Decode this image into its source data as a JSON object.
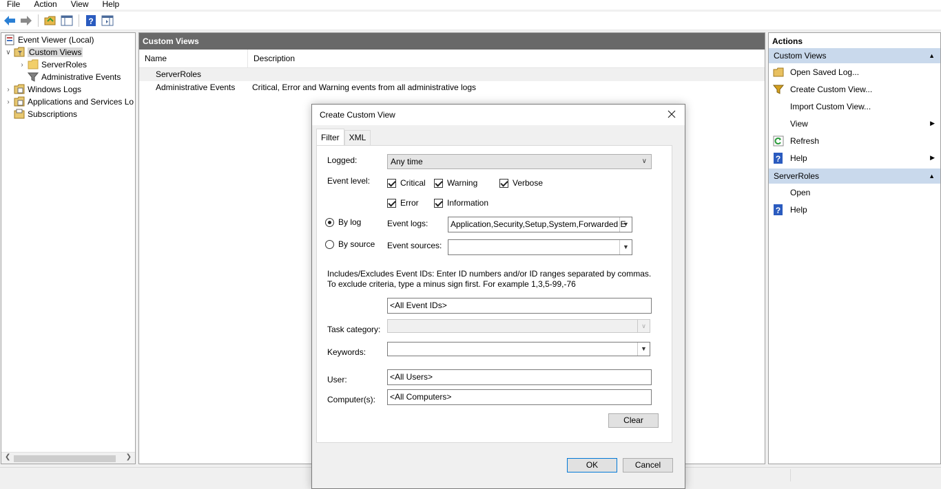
{
  "menu": [
    "File",
    "Action",
    "View",
    "Help"
  ],
  "toolbar": {
    "icons": [
      "back-arrow-icon",
      "forward-arrow-icon",
      "open-folder-icon",
      "show-pane-icon",
      "help-icon",
      "action-pane-icon"
    ]
  },
  "tree": {
    "items": [
      {
        "label": "Event Viewer (Local)",
        "icon": "event-viewer-icon"
      },
      {
        "label": "Custom Views",
        "icon": "custom-views-icon"
      },
      {
        "label": "ServerRoles",
        "icon": "folder-icon"
      },
      {
        "label": "Administrative Events",
        "icon": "filter-icon"
      },
      {
        "label": "Windows Logs",
        "icon": "logs-folder-icon"
      },
      {
        "label": "Applications and Services Lo",
        "icon": "logs-folder-icon"
      },
      {
        "label": "Subscriptions",
        "icon": "subscriptions-icon"
      }
    ]
  },
  "center": {
    "title": "Custom Views",
    "columns": [
      "Name",
      "Description"
    ],
    "rows": [
      {
        "name": "ServerRoles",
        "description": ""
      },
      {
        "name": "Administrative Events",
        "description": "Critical, Error and Warning events from all administrative logs"
      }
    ]
  },
  "actions": {
    "title": "Actions",
    "sections": [
      {
        "header": "Custom Views",
        "items": [
          {
            "label": "Open Saved Log...",
            "icon": "open-log-icon"
          },
          {
            "label": "Create Custom View...",
            "icon": "filter-icon"
          },
          {
            "label": "Import Custom View...",
            "icon": ""
          },
          {
            "label": "View",
            "icon": "",
            "submenu": true
          },
          {
            "label": "Refresh",
            "icon": "refresh-icon"
          },
          {
            "label": "Help",
            "icon": "help-icon",
            "submenu": true
          }
        ]
      },
      {
        "header": "ServerRoles",
        "items": [
          {
            "label": "Open",
            "icon": ""
          },
          {
            "label": "Help",
            "icon": "help-icon"
          }
        ]
      }
    ]
  },
  "dialog": {
    "title": "Create Custom View",
    "tabs": [
      "Filter",
      "XML"
    ],
    "logged_label": "Logged:",
    "logged_value": "Any time",
    "event_level_label": "Event level:",
    "levels": {
      "critical": "Critical",
      "warning": "Warning",
      "verbose": "Verbose",
      "error": "Error",
      "information": "Information"
    },
    "by_log_label": "By log",
    "by_source_label": "By source",
    "event_logs_label": "Event logs:",
    "event_logs_value": "Application,Security,Setup,System,Forwarded E",
    "event_sources_label": "Event sources:",
    "event_sources_value": "",
    "event_ids_description": "Includes/Excludes Event IDs: Enter ID numbers and/or ID ranges separated by commas. To exclude criteria, type a minus sign first. For example 1,3,5-99,-76",
    "event_ids_value": "<All Event IDs>",
    "task_category_label": "Task category:",
    "keywords_label": "Keywords:",
    "user_label": "User:",
    "user_value": "<All Users>",
    "computer_label": "Computer(s):",
    "computer_value": "<All Computers>",
    "clear_label": "Clear",
    "ok_label": "OK",
    "cancel_label": "Cancel"
  },
  "colors": {
    "pane_header": "#696969",
    "action_section": "#c9d9ec",
    "default_button_border": "#0078d7"
  }
}
